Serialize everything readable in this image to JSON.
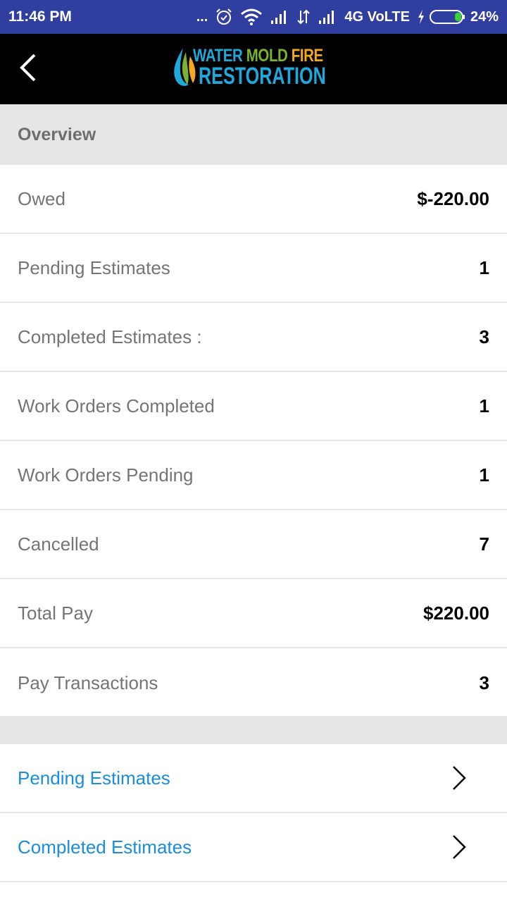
{
  "status_bar": {
    "time": "11:46 PM",
    "dots": "...",
    "network_type": "4G VoLTE",
    "battery_percent": "24%",
    "battery_level": 0.24,
    "background_color": "#303f9f"
  },
  "app_bar": {
    "logo": {
      "word1": "WATER",
      "word2": "MOLD",
      "word3": "FIRE",
      "line2": "RESTORATION"
    },
    "background_color": "#000000"
  },
  "overview": {
    "title": "Overview",
    "rows": [
      {
        "label": "Owed",
        "value": "$-220.00"
      },
      {
        "label": "Pending Estimates",
        "value": "1"
      },
      {
        "label": "Completed Estimates :",
        "value": "3"
      },
      {
        "label": "Work Orders Completed",
        "value": "1"
      },
      {
        "label": "Work Orders Pending",
        "value": "1"
      },
      {
        "label": "Cancelled",
        "value": "7"
      },
      {
        "label": "Total Pay",
        "value": "$220.00"
      },
      {
        "label": "Pay Transactions",
        "value": "3"
      }
    ]
  },
  "links": [
    {
      "label": "Pending Estimates",
      "icon": "chevron-right-icon"
    },
    {
      "label": "Completed Estimates",
      "icon": "chevron-right-icon"
    }
  ],
  "colors": {
    "link": "#1a8ddf",
    "section_bg": "#e6e6e6",
    "label_gray": "#757575"
  }
}
